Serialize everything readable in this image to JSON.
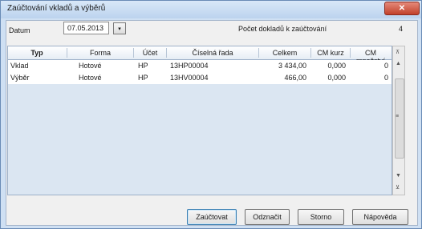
{
  "window": {
    "title": "Zaúčtování vkladů a výběrů",
    "close_glyph": "✕"
  },
  "filter": {
    "date_label": "Datum",
    "date_value": "07.05.2013",
    "dropdown_glyph": "▾",
    "count_label": "Počet dokladů k zaúčtování",
    "count_value": "4"
  },
  "grid": {
    "headers": [
      "Typ",
      "Forma",
      "Účet",
      "Číselná řada",
      "Celkem",
      "CM kurz",
      "CM množství"
    ],
    "rows": [
      [
        "Vklad",
        "Hotové",
        "HP",
        "13HP00004",
        "3 434,00",
        "0,000",
        "0"
      ],
      [
        "Výběr",
        "Hotové",
        "HP",
        "13HV00004",
        "466,00",
        "0,000",
        "0"
      ]
    ]
  },
  "scrollbar": {
    "top_icon": "⊼",
    "up_icon": "▲",
    "grip_icon": "≡",
    "down_icon": "▼",
    "bottom_icon": "⊻"
  },
  "buttons": {
    "post": "Zaúčtovat",
    "unmark": "Odznačit",
    "cancel": "Storno",
    "help": "Nápověda"
  }
}
